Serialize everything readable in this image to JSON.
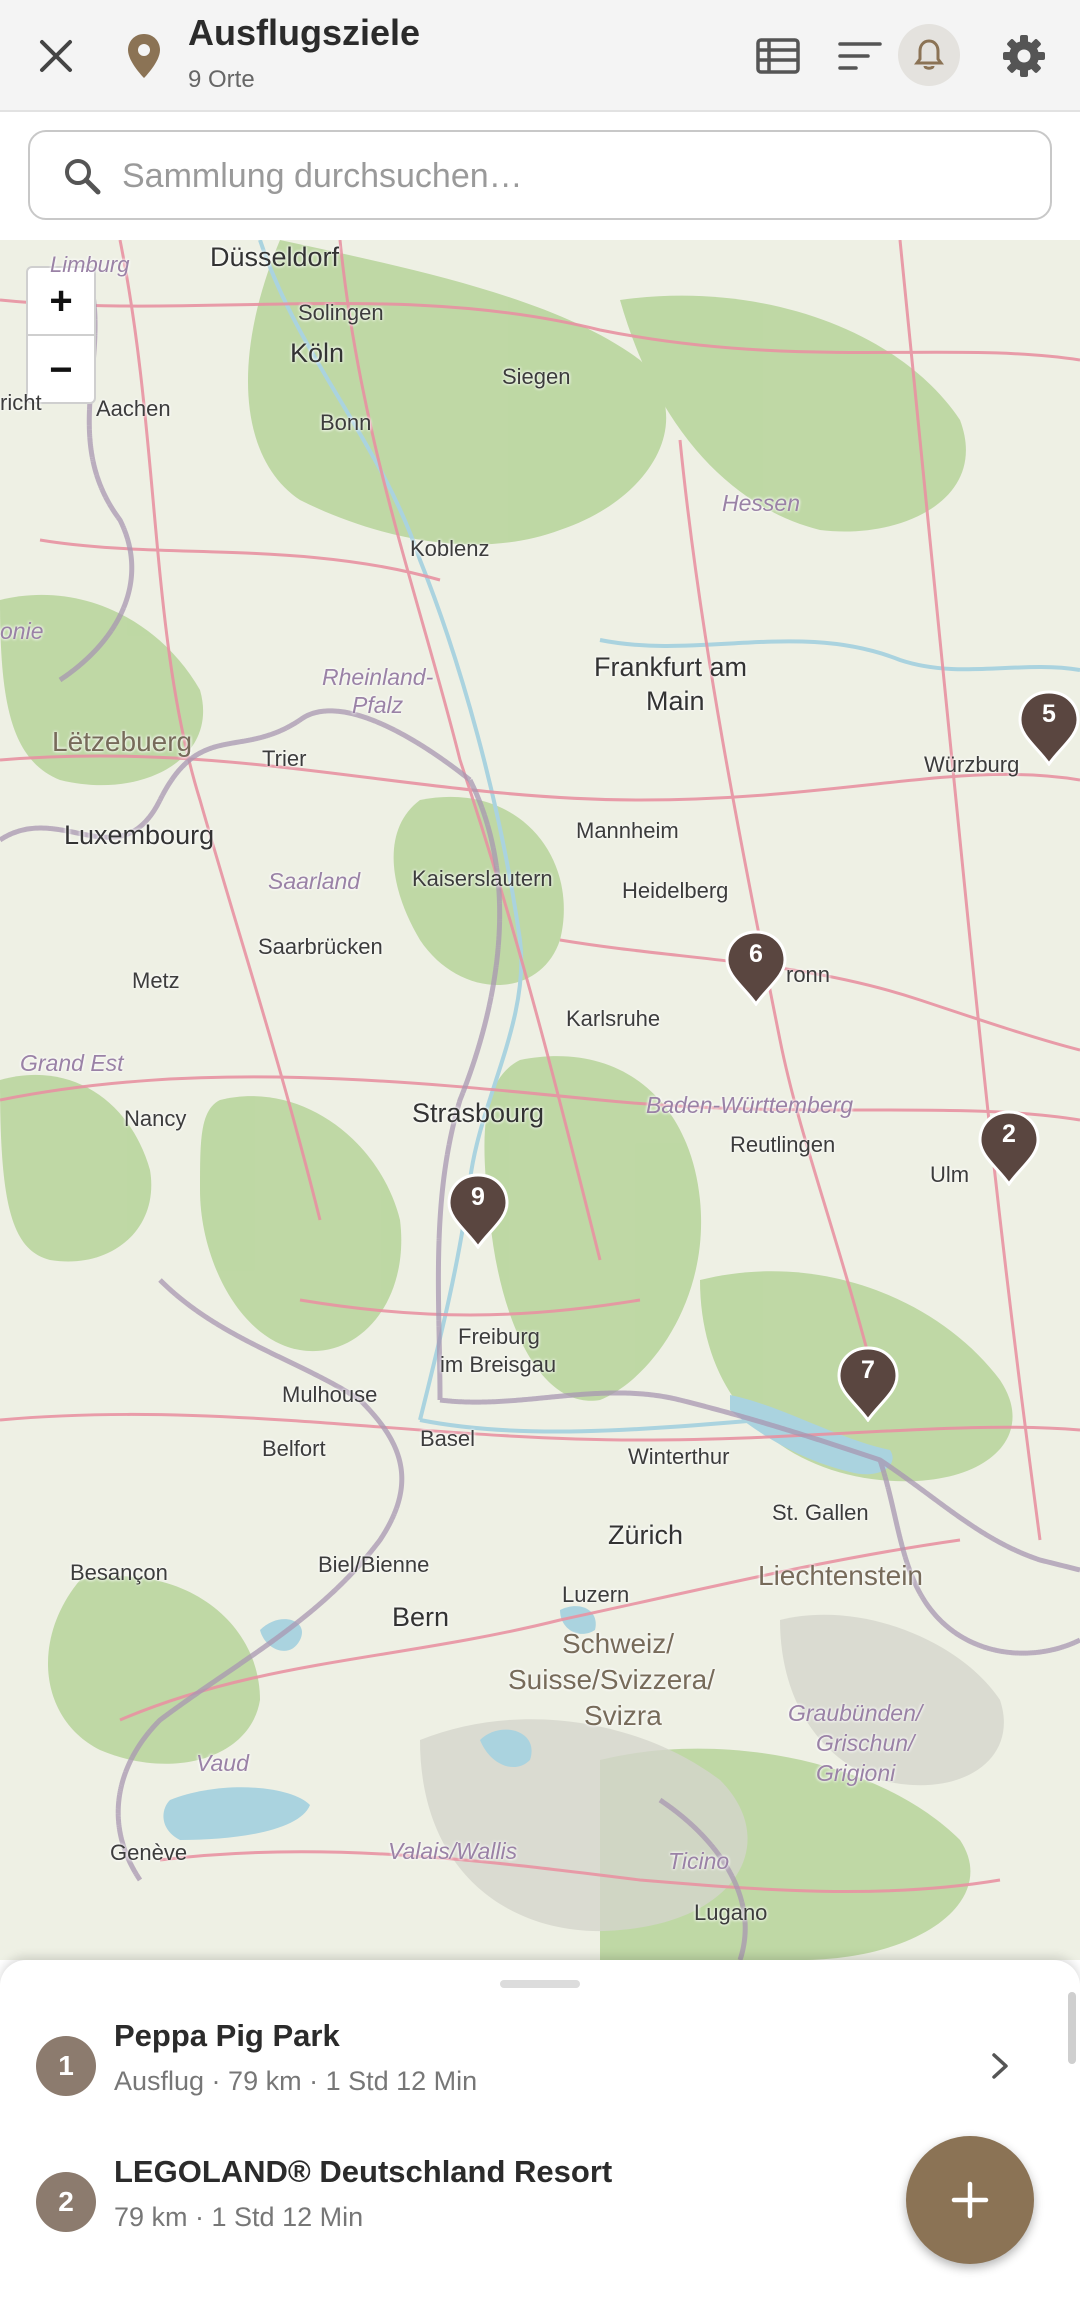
{
  "header": {
    "title": "Ausflugsziele",
    "subtitle": "9 Orte"
  },
  "search": {
    "placeholder": "Sammlung durchsuchen…"
  },
  "map": {
    "zoom_in": "+",
    "zoom_out": "−",
    "labels": {
      "duesseldorf": "Düsseldorf",
      "solingen": "Solingen",
      "koeln": "Köln",
      "aachen": "Aachen",
      "bonn": "Bonn",
      "siegen": "Siegen",
      "hessen": "Hessen",
      "koblenz": "Koblenz",
      "rheinland": "Rheinland-",
      "pfalz": "Pfalz",
      "frankfurt1": "Frankfurt am",
      "frankfurt2": "Main",
      "letzebuerg": "Lëtzebuerg",
      "trier": "Trier",
      "luxembourg": "Luxembourg",
      "wuerzburg": "Würzburg",
      "mannheim": "Mannheim",
      "saarland": "Saarland",
      "kaiserslautern": "Kaiserslautern",
      "heidelberg": "Heidelberg",
      "saarbruecken": "Saarbrücken",
      "metz": "Metz",
      "heilbronn": "ronn",
      "karlsruhe": "Karlsruhe",
      "grandest": "Grand Est",
      "nancy": "Nancy",
      "strasbourg": "Strasbourg",
      "bw": "Baden-Württemberg",
      "reutlingen": "Reutlingen",
      "ulm": "Ulm",
      "freiburg1": "Freiburg",
      "freiburg2": "im Breisgau",
      "mulhouse": "Mulhouse",
      "belfort": "Belfort",
      "basel": "Basel",
      "winterthur": "Winterthur",
      "stgallen": "St. Gallen",
      "zuerich": "Zürich",
      "liechtenstein": "Liechtenstein",
      "besancon": "Besançon",
      "biel": "Biel/Bienne",
      "luzern": "Luzern",
      "bern": "Bern",
      "schweiz1": "Schweiz/",
      "schweiz2": "Suisse/Svizzera/",
      "schweiz3": "Svizra",
      "gr1": "Graubünden/",
      "gr2": "Grischun/",
      "gr3": "Grigioni",
      "vaud": "Vaud",
      "geneve": "Genève",
      "valais": "Valais/Wallis",
      "ticino": "Ticino",
      "lugano": "Lugano",
      "limburg": "Limburg",
      "richt": "richt",
      "onie": "onie"
    },
    "pins": {
      "p5": "5",
      "p6": "6",
      "p2": "2",
      "p9": "9",
      "p7": "7"
    },
    "colors": {
      "pin": "#5a4640",
      "land": "#eef0e4",
      "forest": "#a9cc8e",
      "water": "#aad3df",
      "road": "#e892a2",
      "border": "#9e8fa8"
    }
  },
  "list": {
    "items": [
      {
        "num": "1",
        "title": "Peppa Pig Park",
        "subtitle": "Ausflug · 79 km · 1 Std 12 Min"
      },
      {
        "num": "2",
        "title": "LEGOLAND® Deutschland Resort",
        "subtitle": "79 km · 1 Std 12 Min"
      }
    ]
  },
  "fab": {
    "icon": "plus-icon"
  },
  "icons": {
    "close": "close-icon",
    "place": "map-pin-icon",
    "list": "list-view-icon",
    "sort": "sort-icon",
    "bell": "bell-icon",
    "settings": "gear-icon",
    "search": "search-icon"
  }
}
